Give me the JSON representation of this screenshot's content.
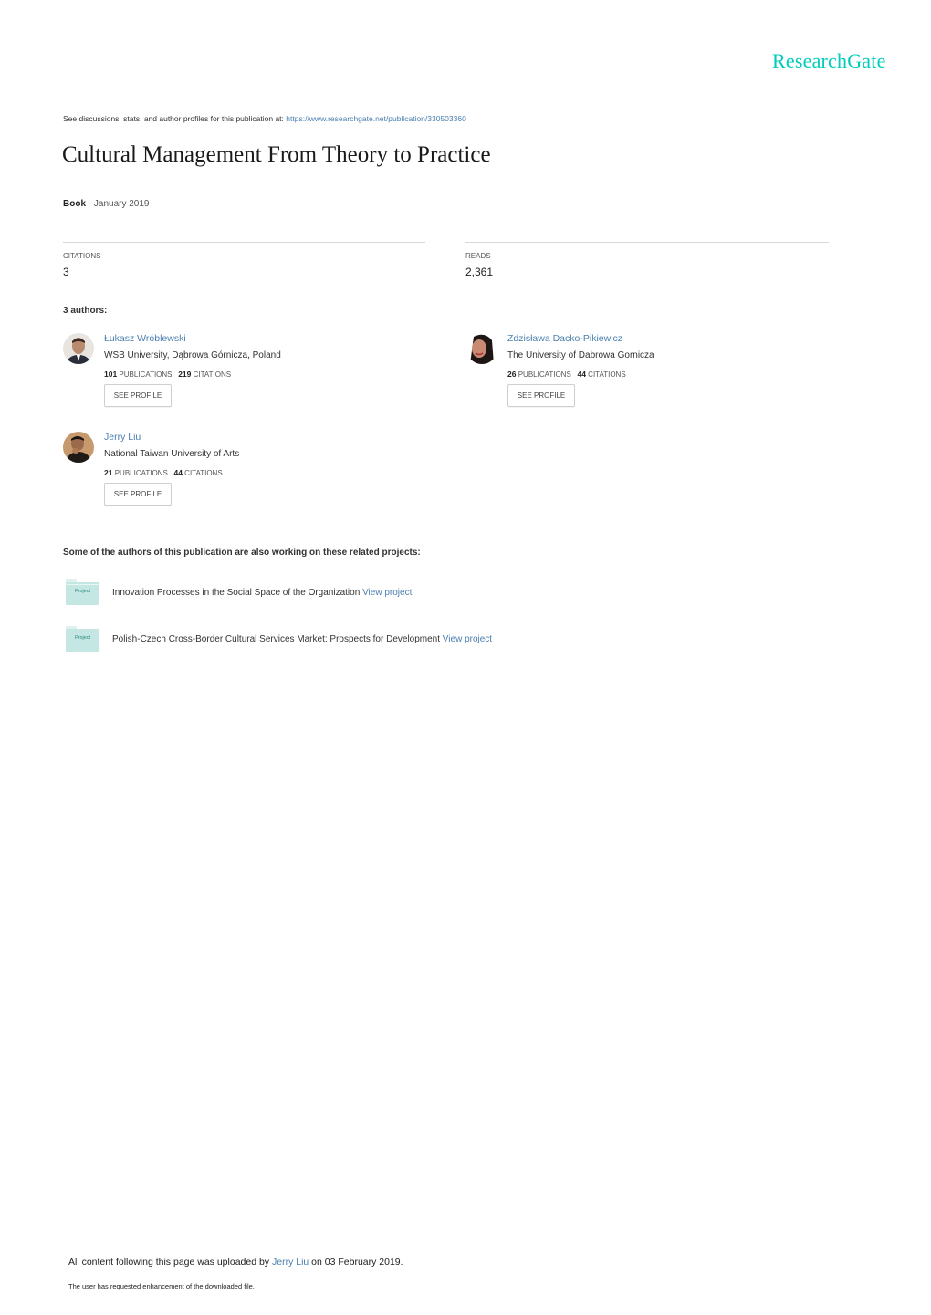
{
  "brand": {
    "logo_text": "ResearchGate",
    "color": "#00ccbb"
  },
  "intro": {
    "text": "See discussions, stats, and author profiles for this publication at: ",
    "url_text": "https://www.researchgate.net/publication/330503360"
  },
  "publication": {
    "title": "Cultural Management From Theory to Practice",
    "type": "Book",
    "separator": " · ",
    "date": "January 2019"
  },
  "stats": {
    "citations_label": "CITATIONS",
    "citations_value": "3",
    "reads_label": "READS",
    "reads_value": "2,361"
  },
  "authors_heading": "3 authors:",
  "authors": [
    {
      "name": "Łukasz Wróblewski",
      "institution": "WSB University, Dąbrowa Górnicza, Poland",
      "publications": "101",
      "publications_label": "PUBLICATIONS",
      "citations": "219",
      "citations_label": "CITATIONS",
      "button_label": "SEE PROFILE"
    },
    {
      "name": "Zdzisława Dacko-Pikiewicz",
      "institution": "The University of Dabrowa Gornicza",
      "publications": "26",
      "publications_label": "PUBLICATIONS",
      "citations": "44",
      "citations_label": "CITATIONS",
      "button_label": "SEE PROFILE"
    },
    {
      "name": "Jerry Liu",
      "institution": "National Taiwan University of Arts",
      "publications": "21",
      "publications_label": "PUBLICATIONS",
      "citations": "44",
      "citations_label": "CITATIONS",
      "button_label": "SEE PROFILE"
    }
  ],
  "projects_heading": "Some of the authors of this publication are also working on these related projects:",
  "projects": [
    {
      "icon_label": "Project",
      "title": "Innovation Processes in the Social Space of the Organization",
      "link_text": "View project"
    },
    {
      "icon_label": "Project",
      "title": "Polish-Czech Cross-Border Cultural Services Market: Prospects for Development",
      "link_text": "View project"
    }
  ],
  "footer": {
    "upload_prefix": "All content following this page was uploaded by ",
    "uploader": "Jerry Liu",
    "upload_suffix": " on 03 February 2019.",
    "note": "The user has requested enhancement of the downloaded file."
  }
}
